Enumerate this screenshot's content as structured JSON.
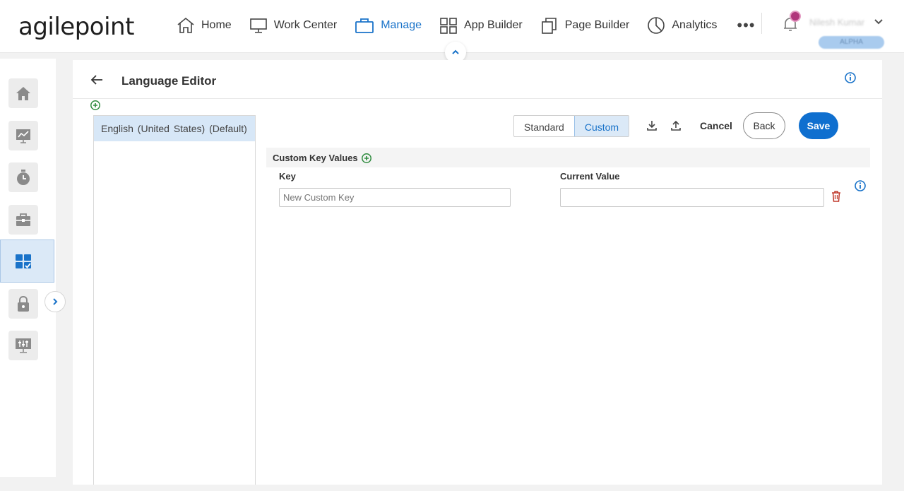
{
  "header": {
    "logo": "agilepoint",
    "nav": [
      {
        "label": "Home",
        "icon": "home-icon"
      },
      {
        "label": "Work Center",
        "icon": "monitor-icon"
      },
      {
        "label": "Manage",
        "icon": "briefcase-icon",
        "active": true
      },
      {
        "label": "App Builder",
        "icon": "grid-icon"
      },
      {
        "label": "Page Builder",
        "icon": "pages-icon"
      },
      {
        "label": "Analytics",
        "icon": "pie-icon"
      }
    ],
    "more": "•••",
    "user_name": "Nilesh Kumar",
    "role": "ALPHA"
  },
  "sidebar": {
    "items": [
      {
        "icon": "home-icon"
      },
      {
        "icon": "chart-icon"
      },
      {
        "icon": "timer-icon"
      },
      {
        "icon": "toolbox-icon"
      },
      {
        "icon": "apps-check-icon",
        "active": true
      },
      {
        "icon": "lock-icon"
      },
      {
        "icon": "monitor-settings-icon"
      }
    ]
  },
  "page": {
    "title": "Language Editor"
  },
  "languages": [
    {
      "label": "English (United States)  (Default)",
      "selected": true
    }
  ],
  "toolbar": {
    "standard_label": "Standard",
    "custom_label": "Custom",
    "cancel_label": "Cancel",
    "back_label": "Back",
    "save_label": "Save"
  },
  "custom_keys": {
    "section_title": "Custom Key Values",
    "key_header": "Key",
    "value_header": "Current Value",
    "key_placeholder": "New Custom Key",
    "key_value": "",
    "current_value": ""
  },
  "colors": {
    "accent": "#1a73c9",
    "save_button": "#0f6fcf",
    "selected_bg": "#d7e7f7",
    "add_icon": "#2e8b3e",
    "delete_icon": "#c0392b"
  }
}
